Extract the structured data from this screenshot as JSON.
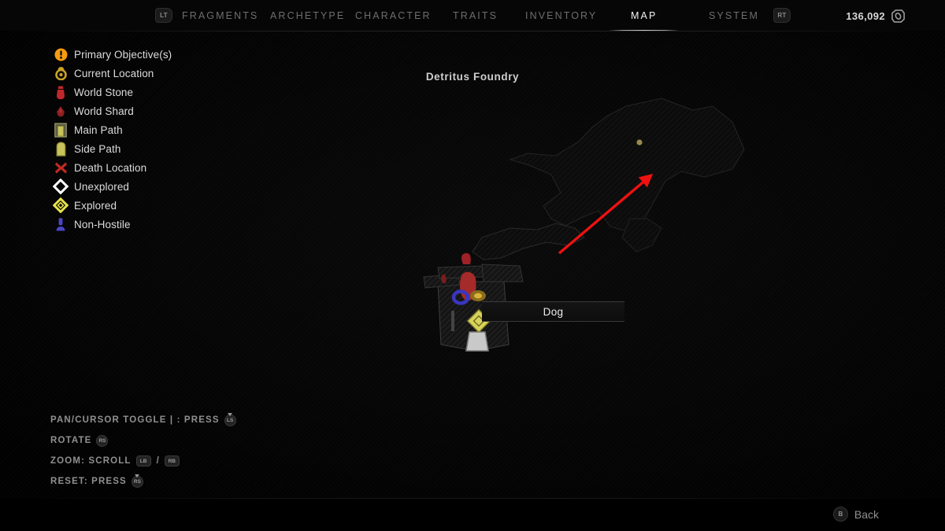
{
  "topbar": {
    "left_bumper": "LT",
    "right_bumper": "RT",
    "tabs": [
      {
        "label": "FRAGMENTS",
        "active": false
      },
      {
        "label": "ARCHETYPE",
        "active": false
      },
      {
        "label": "CHARACTER",
        "active": false
      },
      {
        "label": "TRAITS",
        "active": false
      },
      {
        "label": "INVENTORY",
        "active": false
      },
      {
        "label": "MAP",
        "active": true
      },
      {
        "label": "SYSTEM",
        "active": false
      }
    ],
    "currency": {
      "amount": "136,092",
      "icon": "scrap-icon"
    }
  },
  "map": {
    "title": "Detritus Foundry",
    "tooltip": {
      "label": "Dog"
    },
    "annotation": {
      "type": "red-arrow",
      "color": "#ee1111"
    }
  },
  "legend": {
    "items": [
      {
        "label": "Primary Objective(s)",
        "icon": "objective-icon",
        "color": "#f59a11"
      },
      {
        "label": "Current Location",
        "icon": "current-location-icon",
        "color": "#c9a227"
      },
      {
        "label": "World Stone",
        "icon": "world-stone-icon",
        "color": "#b8252a"
      },
      {
        "label": "World Shard",
        "icon": "world-shard-icon",
        "color": "#8e2020"
      },
      {
        "label": "Main Path",
        "icon": "main-path-icon",
        "color": "#c8c25a"
      },
      {
        "label": "Side Path",
        "icon": "side-path-icon",
        "color": "#c8c25a"
      },
      {
        "label": "Death Location",
        "icon": "death-location-icon",
        "color": "#c02a22"
      },
      {
        "label": "Unexplored",
        "icon": "unexplored-icon",
        "color": "#ffffff"
      },
      {
        "label": "Explored",
        "icon": "explored-icon",
        "color": "#e6e24a"
      },
      {
        "label": "Non-Hostile",
        "icon": "non-hostile-icon",
        "color": "#4a46c8"
      }
    ]
  },
  "controls": {
    "rows": [
      {
        "text": "PAN/CURSOR TOGGLE | : PRESS",
        "buttons": [
          "LS"
        ],
        "style": "stick-press"
      },
      {
        "text": "ROTATE",
        "buttons": [
          "RS"
        ],
        "style": "stick"
      },
      {
        "text": "ZOOM: SCROLL",
        "buttons": [
          "LB",
          "RB"
        ],
        "style": "pad-pair"
      },
      {
        "text": "RESET: PRESS",
        "buttons": [
          "RS"
        ],
        "style": "stick-press"
      }
    ],
    "separator": "/"
  },
  "footer": {
    "back": {
      "label": "Back",
      "button": "B"
    }
  }
}
